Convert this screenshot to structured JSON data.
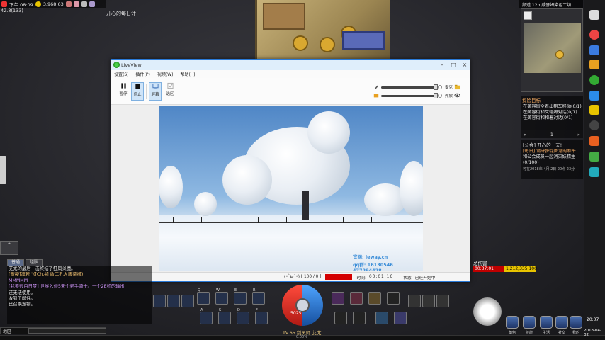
{
  "hud": {
    "time": "下午 08:09",
    "currency": "3,968.63",
    "fps": "42.8(133)",
    "daily_title": "开心的每日计"
  },
  "right_panel": {
    "channel": "频道 12b 威瑟姆染色工坊",
    "quest_title": "探险目标",
    "quests": [
      "在美容街全着出租车移动(0/1)",
      "在美容街和艾德姆对话(0/1)",
      "在美容街和和着对话(0/1)"
    ],
    "page": "1",
    "guild_title": "[公会] 开心的一天!",
    "guild_lines": [
      "[每日] 请守护昆图急的和平",
      "和公会成员一起消灭妖精生",
      "(0/100)"
    ],
    "guild_date": "可在2018年 4月 2日 20点 23分"
  },
  "livestream": {
    "title": "LiveView",
    "menu": [
      "设置(S)",
      "插件(P)",
      "视频(W)",
      "帮助(H)"
    ],
    "toolbar": {
      "pause": "暂停",
      "stop": "停止",
      "screen": "屏幕",
      "window": "选区"
    },
    "sliders": {
      "mic_label": "麦克",
      "speaker_label": "外放"
    },
    "watermark_site": "官网: leway.cn",
    "watermark_qq": "qq群: 16130546  477294428",
    "status": {
      "frame": "(•`ω´•) [ 100 / 0 ]",
      "time_label": "时间:",
      "time": "00:01:16",
      "state_label": "状态:",
      "state": "已经开始中"
    }
  },
  "chat": {
    "tabs": [
      "普通",
      "组队"
    ],
    "lines": [
      "艾尤的最后一击终结了狂风炎魔。",
      "[蔷薇]凛若 \"([Ch.4] 收二孔大服茶报)",
      "MMMMM",
      "[我要很白日梦] 世界入侵5来个老手骑士。一个2E如的输出",
      "还无法使用。",
      "收到了邮件。",
      "已召唤宠物。"
    ],
    "input_label": "地区"
  },
  "hudbottom": {
    "level": "LV.65 剑灵师 艾尤",
    "hp_value": "5025",
    "xp": "0.00%",
    "dmg_label": "总伤害",
    "dmg_time": "00:37:01",
    "dmg_total": "1,212,335,100",
    "menu": [
      "角色",
      "技能",
      "生活",
      "社交",
      "我的"
    ],
    "clock": "20:07",
    "date": "2018-04-02"
  },
  "colors": {
    "accent": "#2a7ad8",
    "record": "#d40000",
    "quest": "#f0a860"
  }
}
